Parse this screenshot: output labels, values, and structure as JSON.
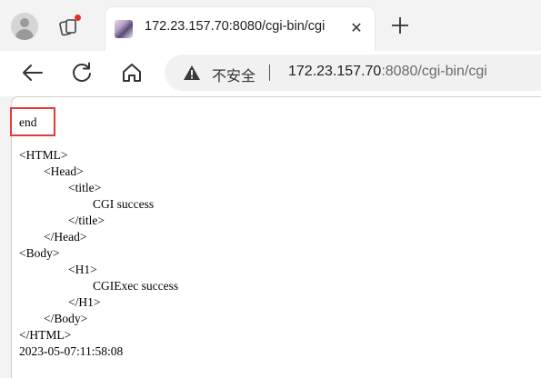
{
  "tab": {
    "title": "172.23.157.70:8080/cgi-bin/cgi",
    "close_glyph": "✕"
  },
  "toolbar": {
    "security_label": "不安全",
    "url_host": "172.23.157.70",
    "url_rest": ":8080/cgi-bin/cgi"
  },
  "page": {
    "end_text": "end",
    "body_lines": [
      "<HTML>",
      "\t<Head>",
      "\t\t<title>",
      "\t\t\tCGI success",
      "\t\t</title>",
      "\t</Head>",
      "<Body>",
      "\t\t<H1>",
      "\t\t\tCGIExec success",
      "\t\t</H1>",
      "\t</Body>",
      "</HTML>",
      "2023-05-07:11:58:08"
    ]
  },
  "colors": {
    "highlight_box": "#e53935",
    "notification_dot": "#e03127"
  },
  "icons": {
    "profile": "profile-avatar-icon",
    "workspaces": "workspaces-icon",
    "back": "back-arrow-icon",
    "reload": "reload-icon",
    "home": "home-icon",
    "new_tab": "plus-icon",
    "security": "warning-triangle-icon"
  }
}
